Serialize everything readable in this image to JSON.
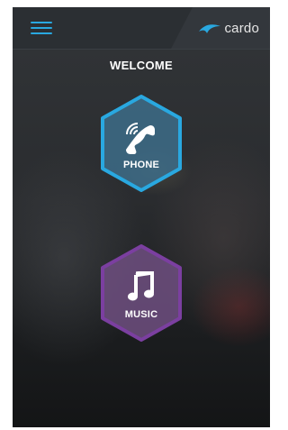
{
  "header": {
    "menu_icon": "hamburger-menu-icon",
    "brand_name": "cardo",
    "brand_mark_icon": "cardo-swoosh-logo-icon"
  },
  "welcome_text": "WELCOME",
  "tiles": [
    {
      "label": "PHONE",
      "icon": "phone-handset-wireless-icon"
    },
    {
      "label": "MUSIC",
      "icon": "music-note-icon"
    }
  ],
  "colors": {
    "accent_blue": "#29a8e0",
    "accent_purple": "#7b3fa0",
    "phone_fill": "#3d6c88",
    "music_fill": "#6f4f80",
    "header_bg": "#2b2f33"
  }
}
